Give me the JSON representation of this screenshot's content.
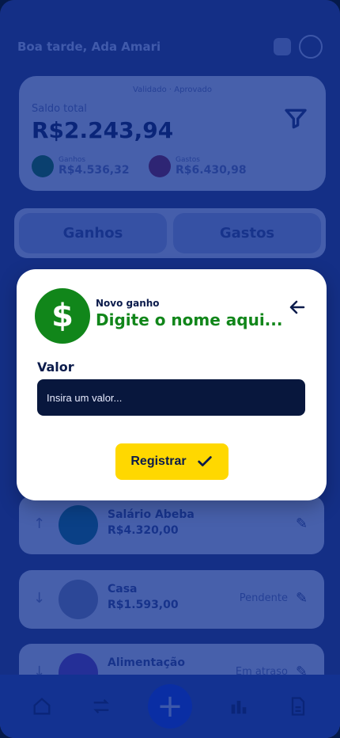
{
  "header": {
    "greeting": "Boa tarde, Ada Amari"
  },
  "balance": {
    "toggle_text": "Validado · Aprovado",
    "label": "Saldo total",
    "value": "R$2.243,94",
    "ganhos": {
      "label": "Ganhos",
      "value": "R$4.536,32"
    },
    "gastos": {
      "label": "Gastos",
      "value": "R$6.430,98"
    }
  },
  "tabs": [
    {
      "label": "Ganhos"
    },
    {
      "label": "Gastos"
    }
  ],
  "list": [
    {
      "name": "Salário Abeba",
      "amount": "R$4.320,00",
      "status": ""
    },
    {
      "name": "Casa",
      "amount": "R$1.593,00",
      "status": "Pendente"
    },
    {
      "name": "Alimentação",
      "amount": "",
      "status": "Em atraso"
    }
  ],
  "modal": {
    "kicker": "Novo ganho",
    "title": "Digite o nome aqui...",
    "value_label": "Valor",
    "input_placeholder": "Insira um valor...",
    "register_label": "Registrar"
  },
  "colors": {
    "green": "#11861a",
    "navy": "#0b1b4b",
    "yellow": "#ffd800",
    "overlay": "#0a2a8a"
  },
  "icons": [
    "dollar-icon",
    "back-arrow-icon",
    "check-icon",
    "filter-icon",
    "plus-icon",
    "home-icon",
    "transfer-icon",
    "chart-icon",
    "document-icon",
    "edit-icon",
    "bell-icon"
  ]
}
